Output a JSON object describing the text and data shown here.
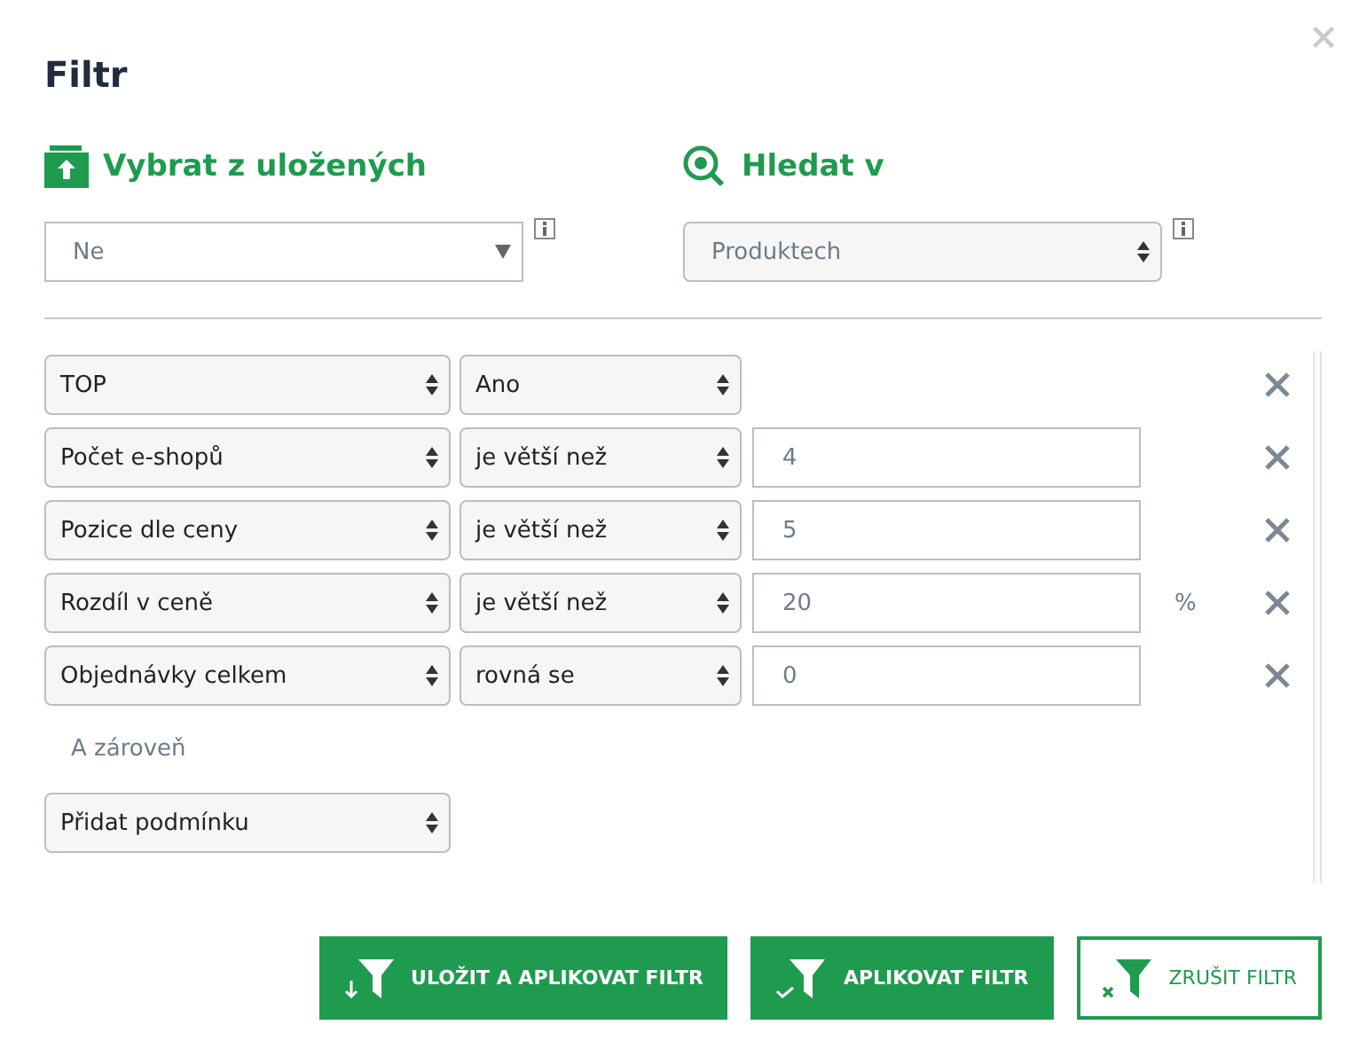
{
  "title": "Filtr",
  "saved": {
    "heading": "Vybrat z uložených",
    "value": "Ne",
    "disabled": false
  },
  "search_in": {
    "heading": "Hledat v",
    "value": "Produktech",
    "disabled": true
  },
  "conditions": [
    {
      "field": "TOP",
      "operator": "Ano"
    },
    {
      "field": "Počet e-shopů",
      "operator": "je větší než",
      "value": "4"
    },
    {
      "field": "Pozice dle ceny",
      "operator": "je větší než",
      "value": "5"
    },
    {
      "field": "Rozdíl v ceně",
      "operator": "je větší než",
      "value": "20",
      "unit": "%"
    },
    {
      "field": "Objednávky celkem",
      "operator": "rovná se",
      "value": "0"
    }
  ],
  "conjunction": "A zároveň",
  "add_condition": "Přidat podmínku",
  "buttons": [
    {
      "label": "ULOŽIT A APLIKOVAT FILTR",
      "kind": "save",
      "primary": true
    },
    {
      "label": "APLIKOVAT FILTR",
      "kind": "apply",
      "primary": true
    },
    {
      "label": "ZRUŠIT FILTR",
      "kind": "cancel",
      "primary": false
    }
  ]
}
